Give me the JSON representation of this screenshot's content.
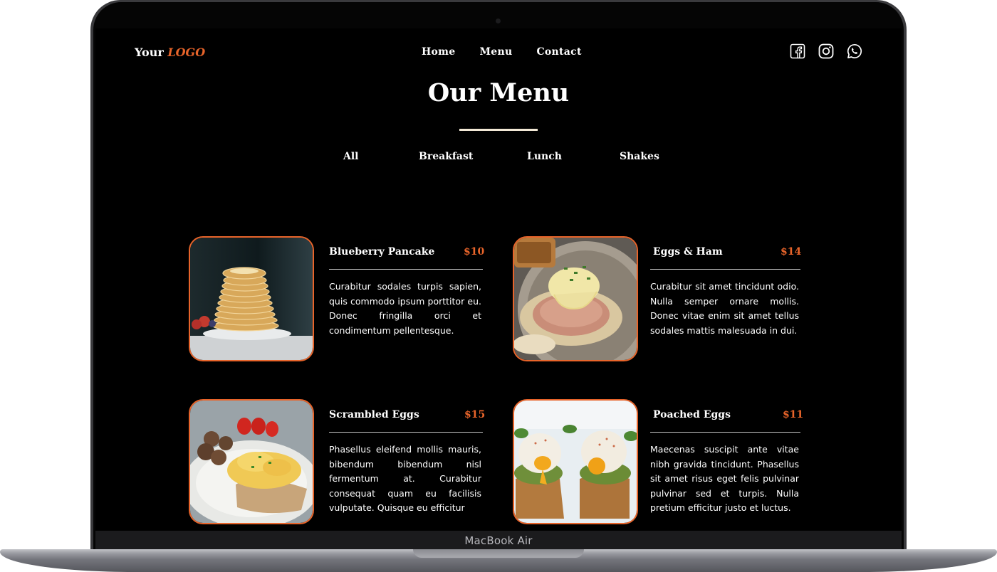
{
  "device": {
    "label": "MacBook Air"
  },
  "header": {
    "logo_prefix": "Your",
    "logo_highlight": "LOGO",
    "nav": [
      "Home",
      "Menu",
      "Contact"
    ],
    "social_icons": [
      "facebook-icon",
      "instagram-icon",
      "whatsapp-icon"
    ]
  },
  "page": {
    "title": "Our Menu"
  },
  "filters": [
    "All",
    "Breakfast",
    "Lunch",
    "Shakes"
  ],
  "accent_color": "#e8642a",
  "menu_items": [
    {
      "name": "Blueberry Pancake",
      "price": "$10",
      "description": "Curabitur sodales turpis sapien, quis commodo ipsum porttitor eu. Donec fringilla orci et condimentum pellentesque."
    },
    {
      "name": "Eggs & Ham",
      "price": "$14",
      "description": "Curabitur sit amet tincidunt odio. Nulla semper ornare mollis. Donec vitae enim sit amet tellus sodales mattis malesuada in dui."
    },
    {
      "name": "Scrambled Eggs",
      "price": "$15",
      "description": "Phasellus eleifend mollis mauris, bibendum bibendum nisl fermentum at. Curabitur consequat quam eu facilisis vulputate. Quisque eu efficitur"
    },
    {
      "name": "Poached Eggs",
      "price": "$11",
      "description": "Maecenas suscipit ante vitae nibh gravida tincidunt. Phasellus sit amet risus eget felis pulvinar pulvinar sed et turpis. Nulla pretium efficitur justo et luctus."
    }
  ]
}
